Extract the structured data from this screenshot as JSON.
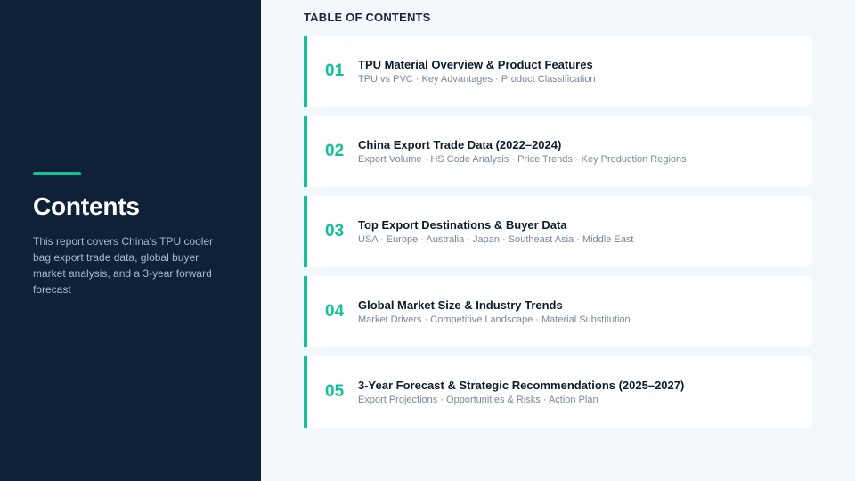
{
  "sidebar": {
    "title": "Contents",
    "description": "This report covers China's TPU cooler bag export trade data, global buyer market analysis, and a 3-year forward forecast"
  },
  "toc": {
    "heading": "TABLE OF CONTENTS",
    "items": [
      {
        "number": "01",
        "title": "TPU Material Overview & Product Features",
        "subtitle": "TPU vs PVC · Key Advantages · Product Classification"
      },
      {
        "number": "02",
        "title": "China Export Trade Data (2022–2024)",
        "subtitle": "Export Volume · HS Code Analysis · Price Trends · Key Production Regions"
      },
      {
        "number": "03",
        "title": "Top Export Destinations & Buyer Data",
        "subtitle": "USA · Europe · Australia · Japan · Southeast Asia · Middle East"
      },
      {
        "number": "04",
        "title": "Global Market Size & Industry Trends",
        "subtitle": "Market Drivers · Competitive Landscape · Material Substitution"
      },
      {
        "number": "05",
        "title": "3-Year Forecast & Strategic Recommendations (2025–2027)",
        "subtitle": "Export Projections · Opportunities & Risks · Action Plan"
      }
    ]
  },
  "colors": {
    "sidebar_bg": "#0f2137",
    "accent": "#12c09a",
    "page_bg": "#f4f7fc",
    "card_bg": "#ffffff"
  }
}
